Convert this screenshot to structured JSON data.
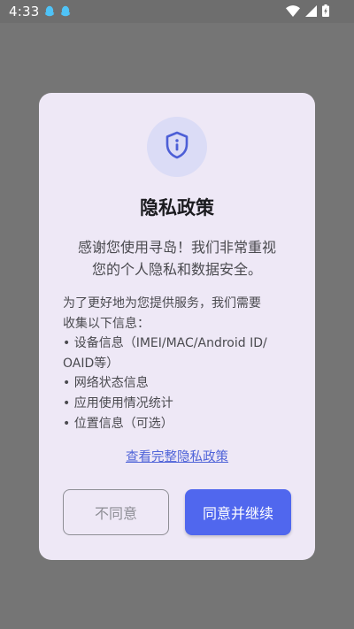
{
  "status_bar": {
    "time": "4:33",
    "left_icons": [
      "qq-icon",
      "qq-icon"
    ],
    "right_icons": [
      "wifi-icon",
      "signal-icon",
      "battery-icon"
    ]
  },
  "dialog": {
    "icon": "shield-info-icon",
    "title": "隐私政策",
    "intro_lines": [
      "感谢您使用寻岛！我们非常重视",
      "您的个人隐私和数据安全。"
    ],
    "info_lines": [
      "为了更好地为您提供服务，我们需要",
      "收集以下信息：",
      "• 设备信息（IMEI/MAC/Android ID/",
      "OAID等）",
      "• 网络状态信息",
      "• 应用使用情况统计",
      "• 位置信息（可选）"
    ],
    "policy_link": "查看完整隐私政策",
    "disagree_label": "不同意",
    "agree_label": "同意并继续"
  },
  "colors": {
    "overlay": "#757575",
    "dialog_bg": "#eee8f6",
    "accent": "#5067ee",
    "link": "#4f63d8",
    "shield_circle": "#dbdcf6"
  }
}
